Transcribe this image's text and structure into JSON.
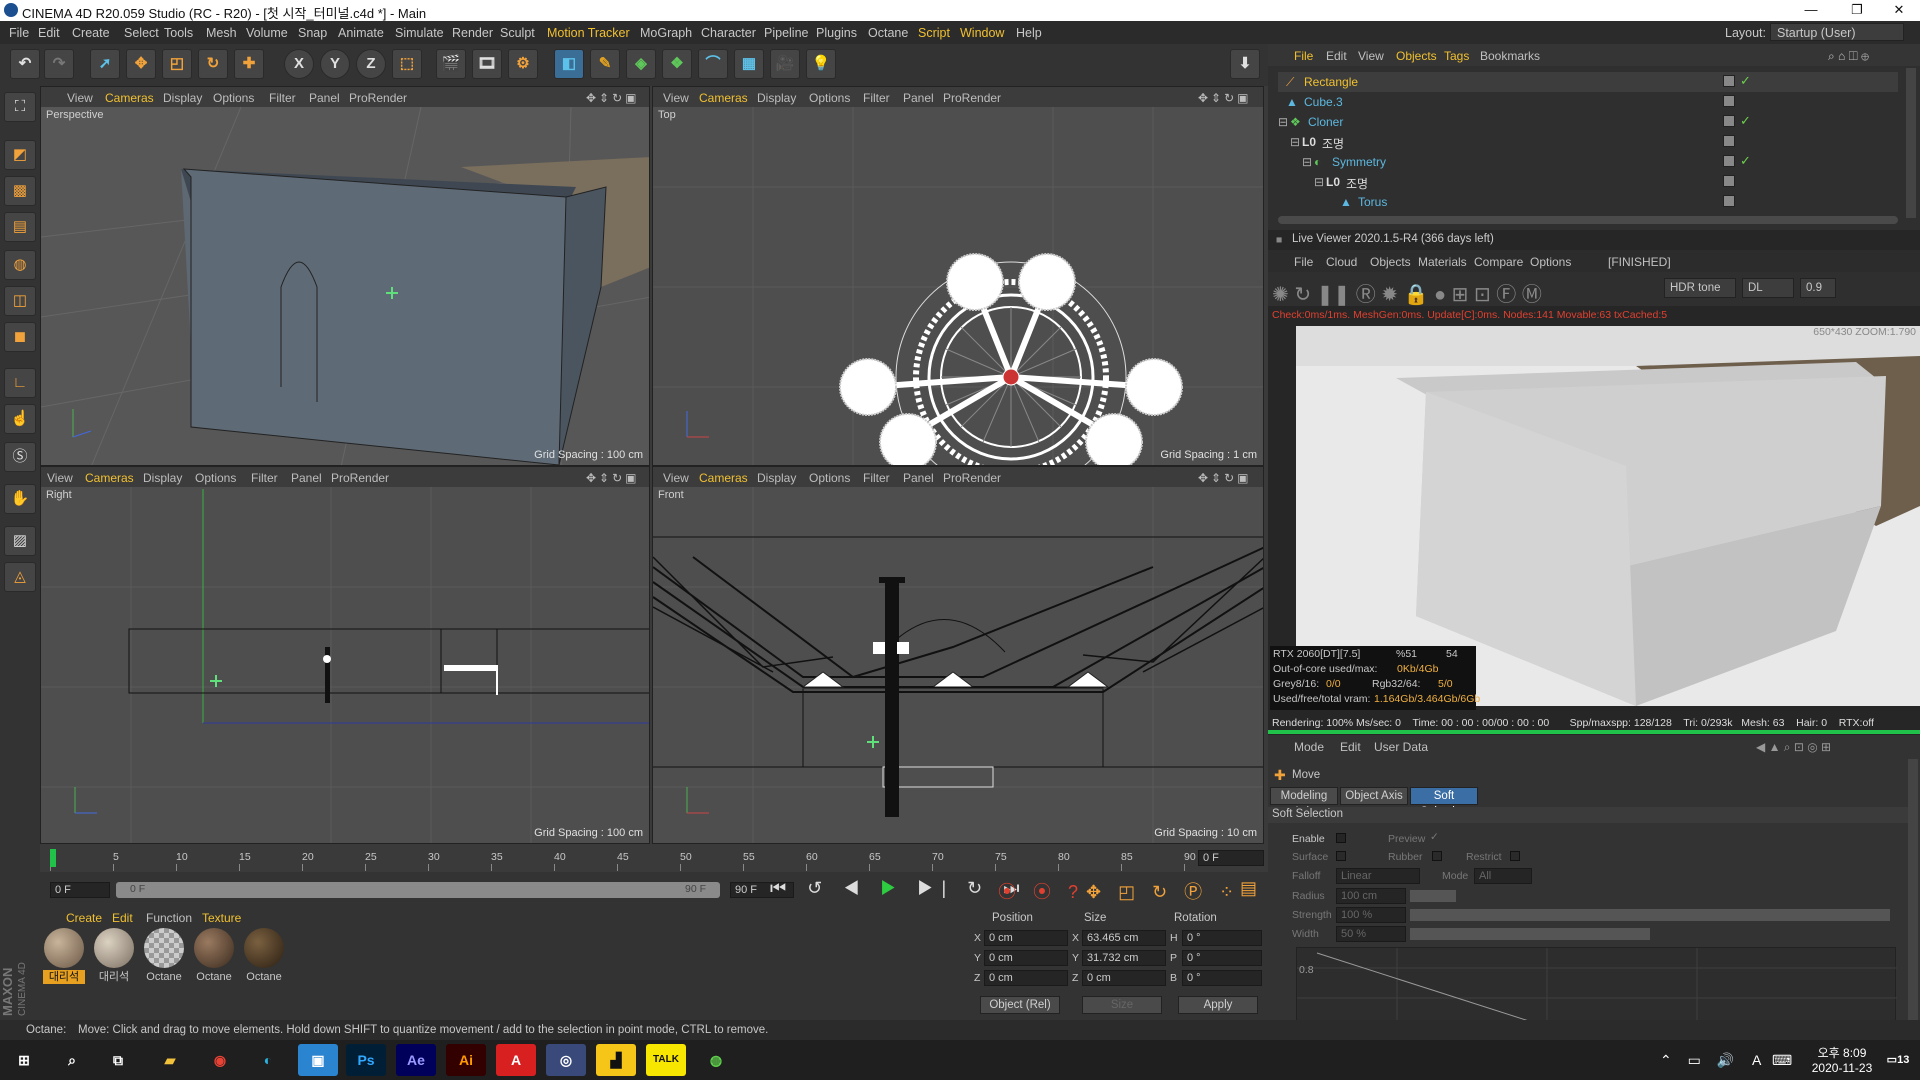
{
  "window": {
    "title": "CINEMA 4D R20.059 Studio (RC - R20) - [첫 시작_터미널.c4d *] - Main",
    "min": "—",
    "restore": "❐",
    "close": "✕"
  },
  "menu": {
    "items": [
      "File",
      "Edit",
      "Create",
      "Select",
      "Tools",
      "Mesh",
      "Volume",
      "Snap",
      "Animate",
      "Simulate",
      "Render",
      "Sculpt",
      "Motion Tracker",
      "MoGraph",
      "Character",
      "Pipeline",
      "Plugins",
      "Octane",
      "Script",
      "Window",
      "Help"
    ],
    "layout_label": "Layout:",
    "layout_value": "Startup (User)"
  },
  "toolbar": {
    "axis_x": "X",
    "axis_y": "Y",
    "axis_z": "Z"
  },
  "viewport_menu": [
    "View",
    "Cameras",
    "Display",
    "Options",
    "Filter",
    "Panel",
    "ProRender"
  ],
  "viewports": {
    "perspective": {
      "name": "Perspective",
      "grid": "Grid Spacing : 100 cm"
    },
    "top": {
      "name": "Top",
      "grid": "Grid Spacing : 1 cm"
    },
    "right": {
      "name": "Right",
      "grid": "Grid Spacing : 100 cm"
    },
    "front": {
      "name": "Front",
      "grid": "Grid Spacing : 10 cm"
    }
  },
  "objects": {
    "menu": [
      "File",
      "Edit",
      "View",
      "Objects",
      "Tags",
      "Bookmarks"
    ],
    "rows": [
      {
        "name": "Rectangle",
        "selected": true
      },
      {
        "name": "Cube.3"
      },
      {
        "name": "Cloner"
      },
      {
        "name": "조명"
      },
      {
        "name": "Symmetry"
      },
      {
        "name": "조명"
      },
      {
        "name": "Torus"
      }
    ]
  },
  "live_viewer": {
    "title": "Live Viewer 2020.1.5-R4 (366 days left)",
    "menu": [
      "File",
      "Cloud",
      "Objects",
      "Materials",
      "Compare",
      "Options"
    ],
    "status": "[FINISHED]",
    "hdr": "HDR tone",
    "dl": "DL",
    "value": "0.9",
    "check": "Check:0ms/1ms. MeshGen:0ms. Update[C]:0ms. Nodes:141 Movable:63 txCached:5",
    "res": "650*430 ZOOM:1.790",
    "gpu": "RTX 2060[DT][7.5]",
    "pct": "%51",
    "temp": "54",
    "ooc": "Out-of-core used/max:",
    "ooc_val": "0Kb/4Gb",
    "grey": "Grey8/16: ",
    "grey_val": "0/0",
    "rgb": "Rgb32/64: ",
    "rgb_val": "5/0",
    "vram": "Used/free/total vram: ",
    "vram_val": "1.164Gb/3.464Gb/6Gb",
    "rendering": "Rendering: 100% Ms/sec: 0    Time: 00 : 00 : 00/00 : 00 : 00       Spp/maxspp: 128/128    Tri: 0/293k   Mesh: 63    Hair: 0    RTX:off"
  },
  "attributes": {
    "menu": [
      "Mode",
      "Edit",
      "User Data"
    ],
    "tool": "Move",
    "tabs": [
      "Modeling Axis",
      "Object Axis",
      "Soft Selection"
    ],
    "section": "Soft Selection",
    "enable": "Enable",
    "preview": "Preview",
    "surface": "Surface",
    "rubber": "Rubber",
    "restrict": "Restrict",
    "falloff": "Falloff",
    "falloff_val": "Linear",
    "mode": "Mode",
    "mode_val": "All",
    "radius": "Radius",
    "radius_val": "100 cm",
    "strength": "Strength",
    "strength_val": "100 %",
    "width": "Width",
    "width_val": "50 %",
    "graph_tick": "0.8"
  },
  "timeline": {
    "ticks": [
      "0",
      "5",
      "10",
      "15",
      "20",
      "25",
      "30",
      "35",
      "40",
      "45",
      "50",
      "55",
      "60",
      "65",
      "70",
      "75",
      "80",
      "85",
      "90"
    ],
    "frame": "0 F"
  },
  "transport": {
    "start": "0 F",
    "range_start": "0 F",
    "range_end": "90 F",
    "end": "90 F"
  },
  "materials": {
    "menu": [
      "Create",
      "Edit",
      "Function",
      "Texture"
    ],
    "items": [
      "대리석",
      "대리석",
      "Octane",
      "Octane",
      "Octane"
    ],
    "brand1": "MAXON",
    "brand2": "CINEMA 4D"
  },
  "coords": {
    "headers": [
      "Position",
      "Size",
      "Rotation"
    ],
    "rows": [
      {
        "axis": "X",
        "pos": "0 cm",
        "size_axis": "X",
        "size": "63.465 cm",
        "rot_axis": "H",
        "rot": "0 °"
      },
      {
        "axis": "Y",
        "pos": "0 cm",
        "size_axis": "Y",
        "size": "31.732 cm",
        "rot_axis": "P",
        "rot": "0 °"
      },
      {
        "axis": "Z",
        "pos": "0 cm",
        "size_axis": "Z",
        "size": "0 cm",
        "rot_axis": "B",
        "rot": "0 °"
      }
    ],
    "mode": "Object (Rel)",
    "size_mode": "Size",
    "apply": "Apply"
  },
  "statusbar": {
    "label": "Octane:",
    "text": "Move: Click and drag to move elements. Hold down SHIFT to quantize movement / add to the selection in point mode, CTRL to remove."
  },
  "taskbar": {
    "time": "오후 8:09",
    "date": "2020-11-23",
    "ime": "A",
    "notify": "13"
  }
}
